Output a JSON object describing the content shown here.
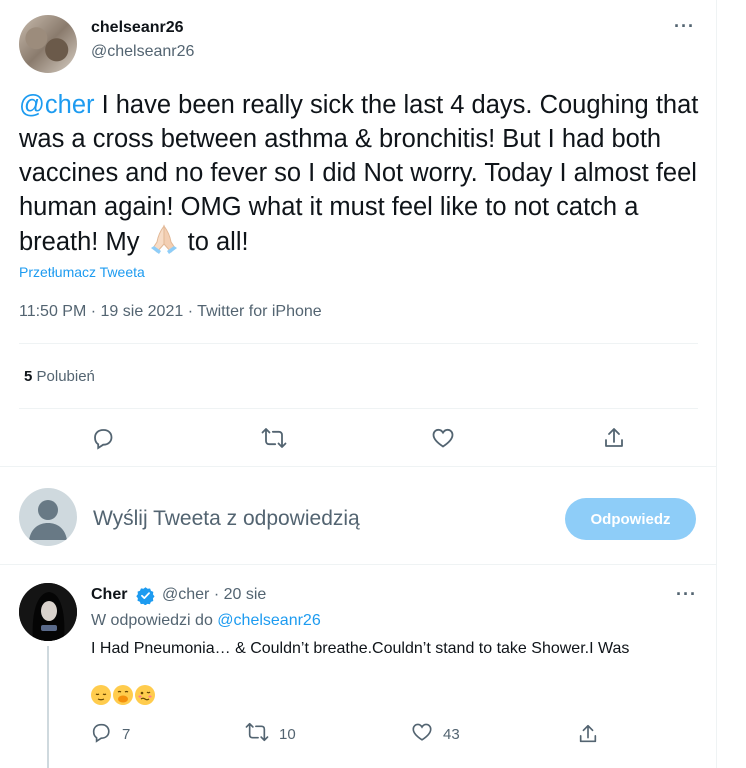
{
  "tweet": {
    "author_name": "chelseanr26",
    "author_handle": "@chelseanr26",
    "mention": "@cher",
    "text": " I have been really sick the last 4 days. Coughing that was a cross between asthma & bronchitis! But I had both vaccines and no fever so I did Not worry. Today I almost feel human again! OMG what it must feel like to not catch a breath! My ",
    "text_after_emoji": " to all!",
    "translate_label": "Przetłumacz Tweeta",
    "timestamp": "11:50 PM · 19 sie 2021 · Twitter for iPhone",
    "likes_count": "5",
    "likes_label": "Polubień"
  },
  "composer": {
    "placeholder": "Wyślij Tweeta z odpowiedzią",
    "reply_button": "Odpowiedz"
  },
  "reply": {
    "author_name": "Cher",
    "meta": "@cher · 20 sie",
    "replying_prefix": "W odpowiedzi do ",
    "replying_to": "@chelseanr26",
    "text": "I Had  Pneumonia… & Couldn’t breathe.Couldn’t stand to take Shower.I Was",
    "reply_count": "7",
    "retweet_count": "10",
    "like_count": "43"
  },
  "colors": {
    "accent": "#1d9bf0",
    "secondary_text": "#536471",
    "reply_button_bg": "#8ecdf8"
  },
  "icons": [
    "more-icon",
    "reply-icon",
    "retweet-icon",
    "like-icon",
    "share-icon",
    "verified-icon",
    "folded-hands-emoji"
  ]
}
